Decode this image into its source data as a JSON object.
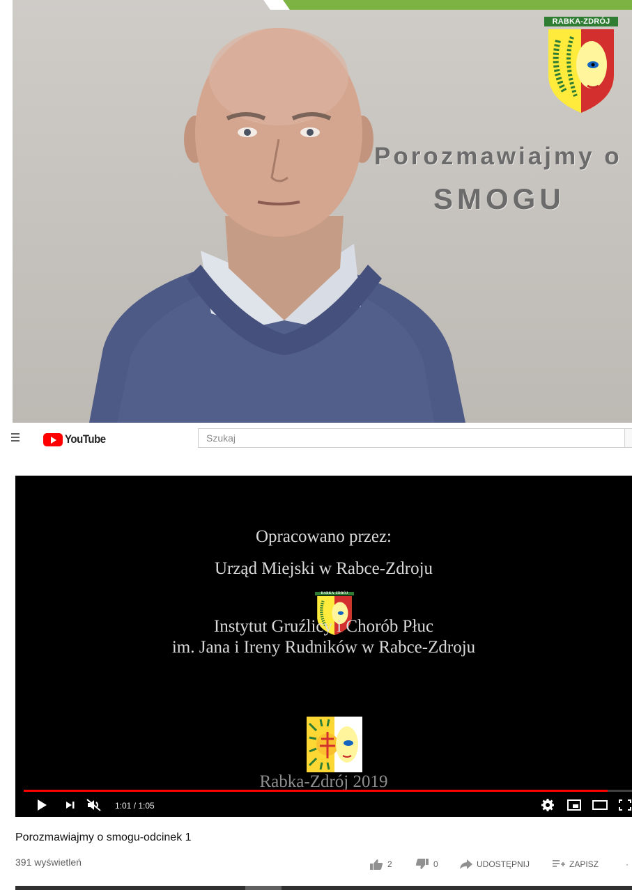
{
  "thumbnail": {
    "logo_label": "RABKA-ZDRÓJ",
    "overlay_line1": "Porozmawiajmy o",
    "overlay_line2": "SMOGU"
  },
  "header": {
    "logo_text": "YouTube",
    "search_placeholder": "Szukaj"
  },
  "player": {
    "credits": {
      "line1": "Opracowano przez:",
      "line2": "Urząd Miejski w Rabce-Zdroju",
      "logo_label": "RABKA-ZDRÓJ",
      "line3": "Instytut Gruźlicy i Chorób Płuc",
      "line4": "im. Jana i Ireny Rudników w Rabce-Zdroju",
      "line5": "Rabka-Zdrój 2019"
    },
    "time_display": "1:01 / 1:05",
    "progress_fraction": 0.96
  },
  "video": {
    "title": "Porozmawiajmy o smogu-odcinek 1",
    "views": "391 wyświetleń",
    "likes": "2",
    "dislikes": "0",
    "share_label": "UDOSTĘPNIJ",
    "save_label": "ZAPISZ"
  },
  "colors": {
    "youtube_red": "#ff0000",
    "header_green": "#7cb342",
    "sweater": "#4e5a86"
  }
}
